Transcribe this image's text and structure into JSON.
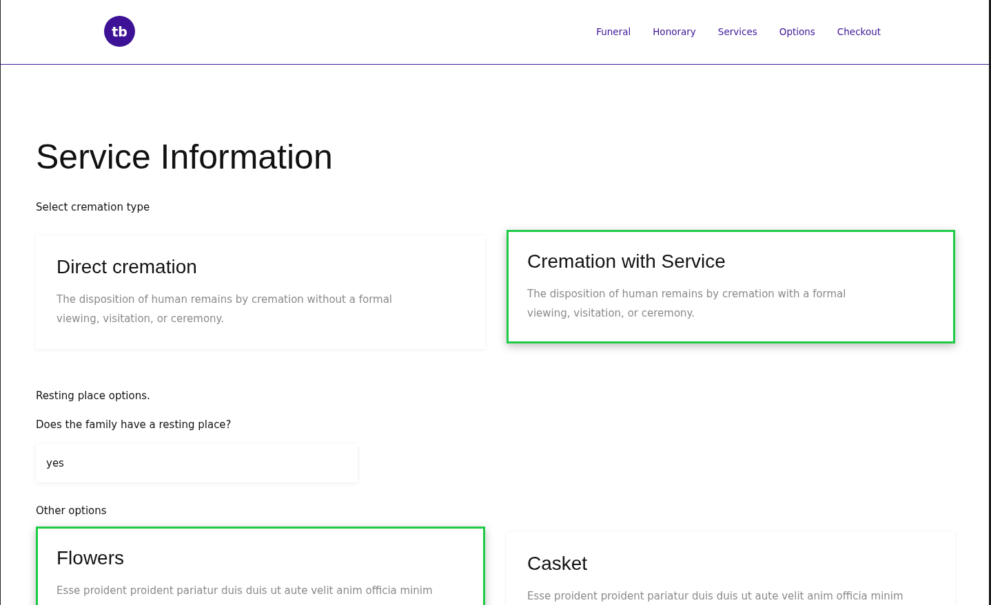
{
  "logo": {
    "text": "tb"
  },
  "nav": [
    {
      "label": "Funeral"
    },
    {
      "label": "Honorary"
    },
    {
      "label": "Services"
    },
    {
      "label": "Options"
    },
    {
      "label": "Checkout"
    }
  ],
  "title": "Service Information",
  "cremation": {
    "label": "Select cremation type",
    "options": [
      {
        "title": "Direct cremation",
        "description": "The disposition of human remains by cremation without a formal viewing, visitation, or ceremony.",
        "selected": false
      },
      {
        "title": "Cremation with Service",
        "description": "The disposition of human remains by cremation with a formal viewing, visitation, or ceremony.",
        "selected": true
      }
    ]
  },
  "resting": {
    "heading": "Resting place options.",
    "question": "Does the family have a resting place?",
    "value": "yes"
  },
  "other": {
    "label": "Other options",
    "options": [
      {
        "title": "Flowers",
        "description": "Esse proident proident pariatur duis duis ut aute velit anim officia minim",
        "selected": true
      },
      {
        "title": "Casket",
        "description": "Esse proident proident pariatur duis duis ut aute velit anim officia minim",
        "selected": false
      }
    ]
  }
}
